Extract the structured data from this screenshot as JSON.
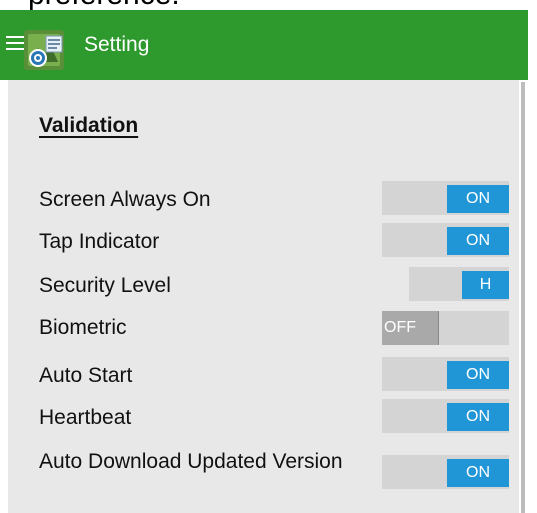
{
  "top_cropped_text": "preference.",
  "app_bar": {
    "title": "Setting",
    "color": "#2e9a2e"
  },
  "section": {
    "heading": "Validation"
  },
  "settings": [
    {
      "label": "Screen Always On",
      "state": "ON"
    },
    {
      "label": "Tap Indicator",
      "state": "ON"
    },
    {
      "label": "Security Level",
      "state": "H"
    },
    {
      "label": "Biometric",
      "state": "OFF"
    },
    {
      "label": "Auto Start",
      "state": "ON"
    },
    {
      "label": "Heartbeat",
      "state": "ON"
    },
    {
      "label": "Auto Download Updated Version",
      "state": "ON"
    }
  ],
  "colors": {
    "toggle_on": "#2196d6",
    "toggle_track": "#d4d4d4",
    "toggle_off_knob": "#a9a9a9",
    "background": "#e8e8e8"
  }
}
